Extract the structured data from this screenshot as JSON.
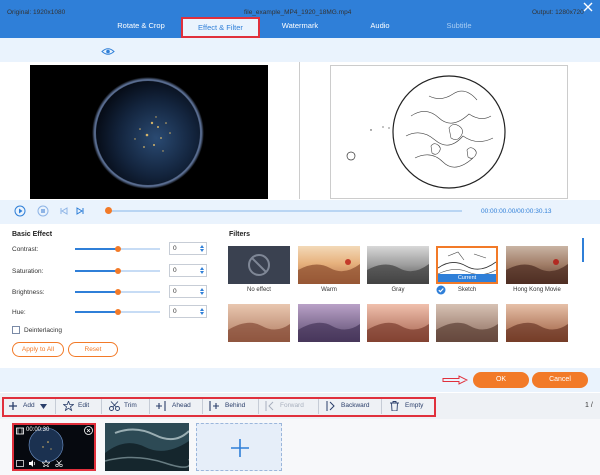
{
  "tabs": [
    {
      "label": "Rotate & Crop"
    },
    {
      "label": "Effect & Filter"
    },
    {
      "label": "Watermark"
    },
    {
      "label": "Audio"
    },
    {
      "label": "Subtitle"
    }
  ],
  "info": {
    "original": "Original: 1920x1080",
    "filename": "file_example_MP4_1920_18MG.mp4",
    "output": "Output: 1280x720"
  },
  "player": {
    "timecode": "00:00:00.00/00:00:30.13",
    "progress": 0.0
  },
  "basic_effect": {
    "title": "Basic Effect",
    "sliders": [
      {
        "label": "Contrast:",
        "value": "0",
        "level": 0.5
      },
      {
        "label": "Saturation:",
        "value": "0",
        "level": 0.5
      },
      {
        "label": "Brightness:",
        "value": "0",
        "level": 0.5
      },
      {
        "label": "Hue:",
        "value": "0",
        "level": 0.5
      }
    ],
    "deinterlacing": "Deinterlacing",
    "apply_all": "Apply to All",
    "reset": "Reset"
  },
  "filters": {
    "title": "Filters",
    "items": [
      {
        "label": "No effect"
      },
      {
        "label": "Warm"
      },
      {
        "label": "Gray"
      },
      {
        "label": "Sketch",
        "badge": "Current"
      },
      {
        "label": "Hong Kong Movie"
      }
    ]
  },
  "actions": {
    "ok": "OK",
    "cancel": "Cancel"
  },
  "toolbar": {
    "add": "Add",
    "edit": "Edit",
    "trim": "Trim",
    "ahead": "Ahead",
    "behind": "Behind",
    "forward": "Forward",
    "backward": "Backward",
    "empty": "Empty",
    "page": "1 /"
  },
  "timeline": {
    "clip1_duration": "00:00:30"
  },
  "colors": {
    "accent": "#2f7fd8",
    "orange": "#f27a28",
    "highlight": "#e0303c"
  }
}
